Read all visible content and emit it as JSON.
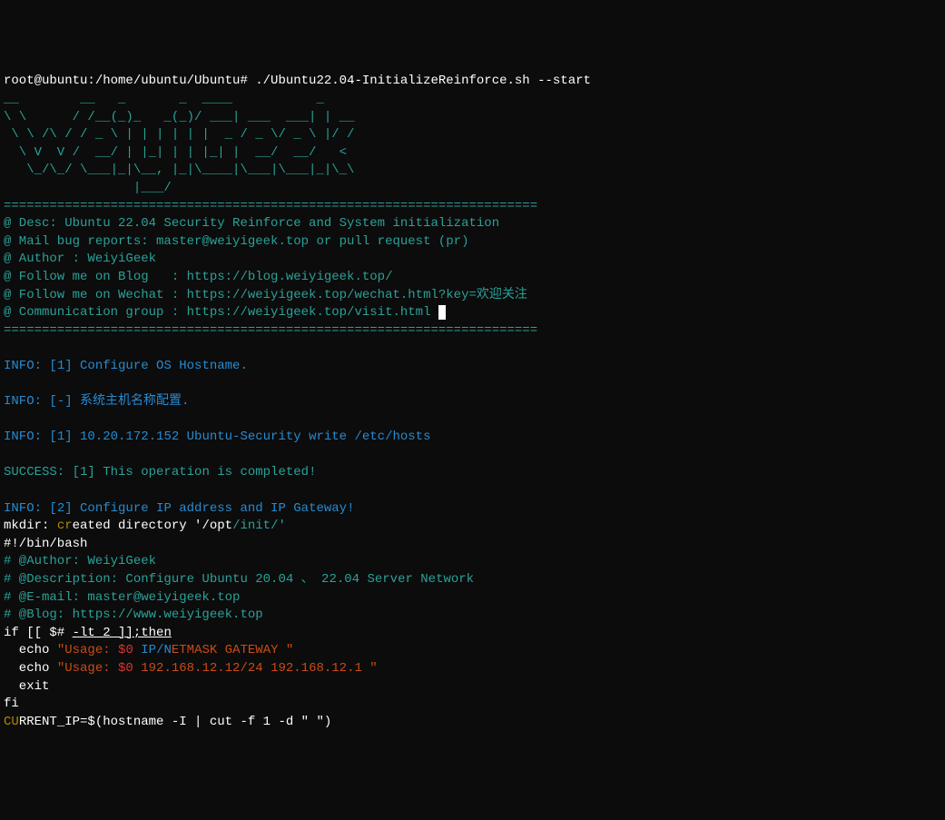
{
  "prompt": {
    "user_host": "root@ubuntu:/home/ubuntu/Ubuntu#",
    "command": "./Ubuntu22.04-InitializeReinforce.sh --start"
  },
  "ascii": {
    "l1": "__        __   _       _  ____           _    ",
    "l2": "\\ \\      / /__(_)_   _(_)/ ___| ___  ___| | __",
    "l3": " \\ \\ /\\ / / _ \\ | | | | | |  _ / _ \\/ _ \\ |/ /",
    "l4": "  \\ V  V /  __/ | |_| | | |_| |  __/  __/   < ",
    "l5": "   \\_/\\_/ \\___|_|\\__, |_|\\____|\\___|\\___|_|\\_\\",
    "l6": "                 |___/                        "
  },
  "sep": "======================================================================",
  "header": {
    "desc": "@ Desc: Ubuntu 22.04 Security Reinforce and System initialization",
    "mail": "@ Mail bug reports: master@weiyigeek.top or pull request (pr)",
    "author": "@ Author : WeiyiGeek",
    "blog": "@ Follow me on Blog   : https://blog.weiyigeek.top/",
    "wechat": "@ Follow me on Wechat : https://weiyigeek.top/wechat.html?key=欢迎关注",
    "comm_pre": "@ Communication group : https://weiyigeek.top/visit.html "
  },
  "logs": {
    "info1_label": "INFO:",
    "info1_text": " [1] Configure OS Hostname.",
    "info2_label": "INFO:",
    "info2_text": " [-] 系统主机名称配置.",
    "info3_label": "INFO:",
    "info3_text": " [1] 10.20.172.152 Ubuntu-Security write /etc/hosts",
    "success_label": "SUCCESS:",
    "success_text": " [1] This operation is completed!",
    "info4_label": "INFO:",
    "info4_text": " [2] Configure IP address and IP Gateway!"
  },
  "mkdir": {
    "p1": "mkdir: ",
    "p2": "cr",
    "p3": "eated directory '/opt",
    "p4": "/init/'"
  },
  "script": {
    "shebang": "#!/bin/bash",
    "author": "# @Author: WeiyiGeek",
    "desc": "# @Description: Configure Ubuntu 20.04 、 22.04 Server Network",
    "email": "# @E-mail: master@weiyigeek.top",
    "blog": "# @Blog: https://www.weiyigeek.top",
    "if_pre": "if [[ $# ",
    "if_cond": "-lt 2 ]];then",
    "echo1_pre": "  echo ",
    "echo1_q1": "\"U",
    "echo1_sage": "sage: ",
    "echo1_arg": "$0",
    "echo1_sp": " ",
    "echo1_ipn": "IP/N",
    "echo1_rest": "ETMASK GATEWAY \"",
    "echo2_pre": "  echo ",
    "echo2_q1": "\"Usage: ",
    "echo2_arg": "$0",
    "echo2_rest": " 192.168.12.12/24 192.168.12.1 \"",
    "exit": "  exit",
    "fi": "fi",
    "cu": "CU",
    "curr_rest": "RRENT_IP=$(hostname -I | cut -f 1 -d \" \")"
  }
}
